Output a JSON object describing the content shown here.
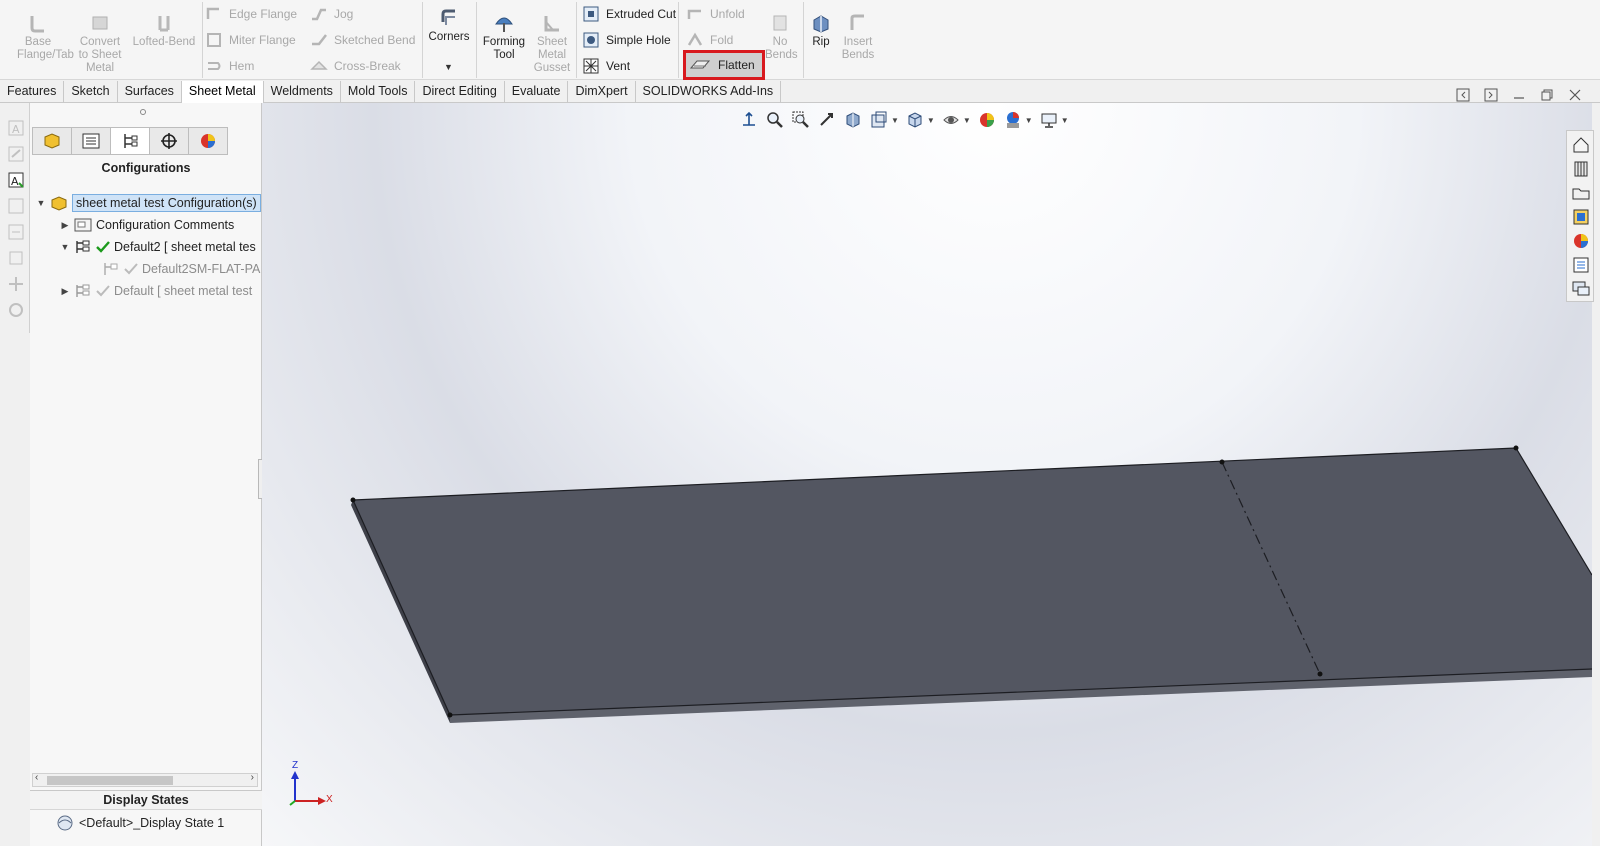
{
  "ribbon": {
    "base_flange": "Base Flange/Tab",
    "convert": "Convert to Sheet Metal",
    "lofted_bend": "Lofted-Bend",
    "edge_flange": "Edge Flange",
    "miter_flange": "Miter Flange",
    "hem": "Hem",
    "jog": "Jog",
    "sketched_bend": "Sketched Bend",
    "cross_break": "Cross-Break",
    "corners": "Corners",
    "forming_tool": "Forming Tool",
    "gusset": "Sheet Metal Gusset",
    "extruded_cut": "Extruded Cut",
    "simple_hole": "Simple Hole",
    "vent": "Vent",
    "unfold": "Unfold",
    "fold": "Fold",
    "flatten": "Flatten",
    "no_bends": "No Bends",
    "rip": "Rip",
    "insert_bends": "Insert Bends"
  },
  "tabs": [
    "Features",
    "Sketch",
    "Surfaces",
    "Sheet Metal",
    "Weldments",
    "Mold Tools",
    "Direct Editing",
    "Evaluate",
    "DimXpert",
    "SOLIDWORKS Add-Ins"
  ],
  "active_tab": "Sheet Metal",
  "panel": {
    "title": "Configurations",
    "tree": {
      "root": "sheet metal test Configuration(s)",
      "comments": "Configuration Comments",
      "default2": "Default2 [ sheet metal tes",
      "default2_child": "Default2SM-FLAT-PA",
      "default": "Default [ sheet metal test"
    },
    "display_states_title": "Display States",
    "display_state": "<Default>_Display State 1"
  },
  "triad": {
    "z": "Z",
    "x": "X"
  },
  "colors": {
    "accent_red": "#d8191e",
    "part_face": "#535661",
    "selection": "#cfe3f7"
  }
}
